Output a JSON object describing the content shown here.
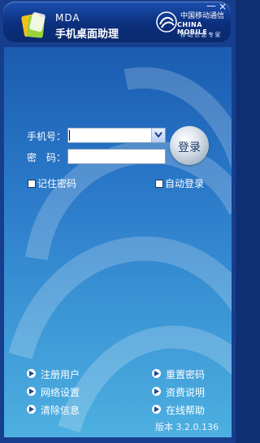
{
  "window": {
    "minimize_glyph": "—",
    "close_glyph": "×"
  },
  "header": {
    "app_mark": "MDA",
    "app_name": "手机桌面助理",
    "carrier_cn": "中国移动通信",
    "carrier_en": "CHINA MOBILE",
    "carrier_slogan": "移动信息专家"
  },
  "login": {
    "phone_label": "手机号：",
    "phone_value": "",
    "password_label": "密　码：",
    "password_value": "",
    "login_button": "登录",
    "remember_label": "记住密码",
    "remember_checked": false,
    "auto_label": "自动登录",
    "auto_checked": false
  },
  "links": {
    "register": "注册用户",
    "network": "网络设置",
    "clear": "清除信息",
    "reset": "重置密码",
    "fees": "资费说明",
    "help": "在线帮助"
  },
  "version": "版本 3.2.0.136",
  "colors": {
    "panel_top": "#1a5cb0",
    "panel_bottom": "#4db0e0",
    "header": "#0c2f7e"
  }
}
